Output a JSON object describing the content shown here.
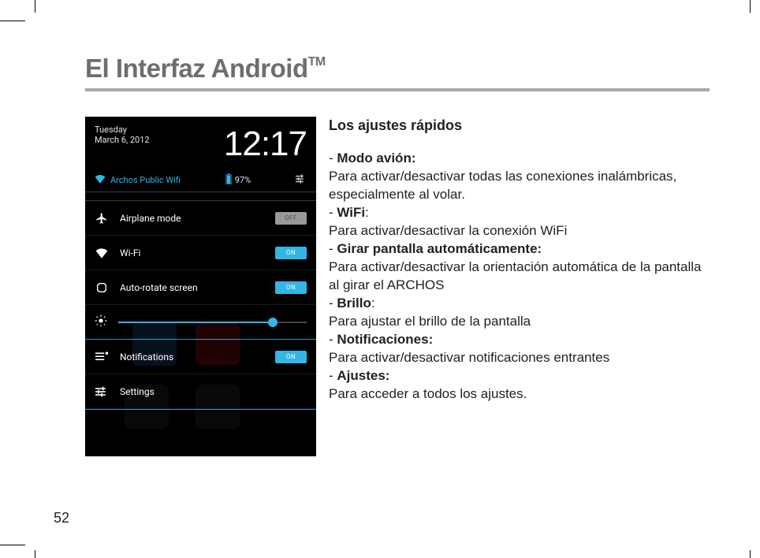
{
  "title_main": "El Interfaz Android",
  "title_tm": "TM",
  "page_number": "52",
  "phone": {
    "date_line1": "Tuesday",
    "date_line2": "March 6, 2012",
    "clock": "12:17",
    "wifi_network": "Archos Public Wifi",
    "battery": "97%",
    "rows": {
      "airplane": {
        "label": "Airplane mode",
        "toggle": "OFF"
      },
      "wifi": {
        "label": "Wi-Fi",
        "toggle": "ON"
      },
      "autorotate": {
        "label": "Auto-rotate screen",
        "toggle": "ON"
      },
      "notifications": {
        "label": "Notifications",
        "toggle": "ON"
      },
      "settings": {
        "label": "Settings"
      }
    },
    "slider_pct": 82
  },
  "text": {
    "heading": "Los ajustes rápidos",
    "items": [
      {
        "title": "Modo avión:",
        "desc": "Para activar/desactivar todas las conexiones inalámbricas, especialmente al volar."
      },
      {
        "title": "WiFi",
        "suffix": ":",
        "desc": "Para activar/desactivar la conexión WiFi"
      },
      {
        "title": "Girar pantalla automáticamente:",
        "desc": "Para activar/desactivar la orientación automática de la pantalla al girar el ARCHOS"
      },
      {
        "title": "Brillo",
        "suffix": ":",
        "desc": "Para ajustar el brillo de la pantalla"
      },
      {
        "title": "Notificaciones:",
        "desc": "Para activar/desactivar notificaciones entrantes"
      },
      {
        "title": "Ajustes:",
        "desc": "Para acceder a todos los ajustes."
      }
    ]
  }
}
